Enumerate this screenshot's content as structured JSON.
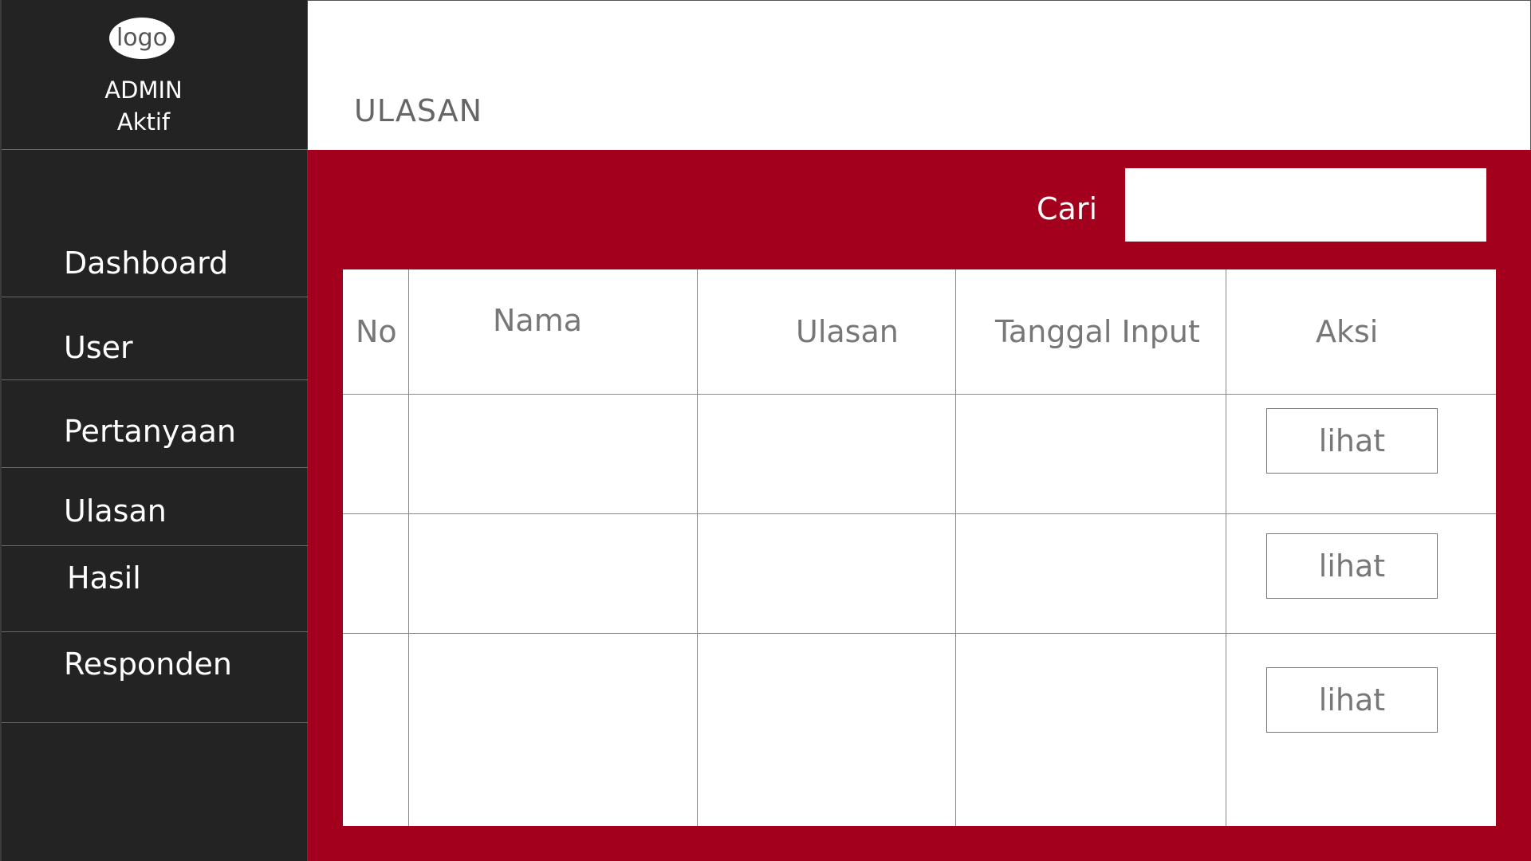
{
  "sidebar": {
    "logo_text": "logo",
    "admin_name": "ADMIN",
    "admin_status": "Aktif",
    "items": [
      {
        "label": "Dashboard"
      },
      {
        "label": "User"
      },
      {
        "label": "Pertanyaan"
      },
      {
        "label": "Ulasan"
      },
      {
        "label": "Hasil"
      },
      {
        "label": "Responden"
      }
    ]
  },
  "header": {
    "title": "ULASAN"
  },
  "search": {
    "label": "Cari",
    "value": "",
    "placeholder": ""
  },
  "table": {
    "columns": [
      "No",
      "Nama",
      "Ulasan",
      "Tanggal Input",
      "Aksi"
    ],
    "rows": [
      {
        "action": "lihat"
      },
      {
        "action": "lihat"
      },
      {
        "action": "lihat"
      }
    ]
  },
  "colors": {
    "sidebar_bg": "#232323",
    "accent_red": "#a3001d",
    "header_bg": "#ffffff"
  }
}
